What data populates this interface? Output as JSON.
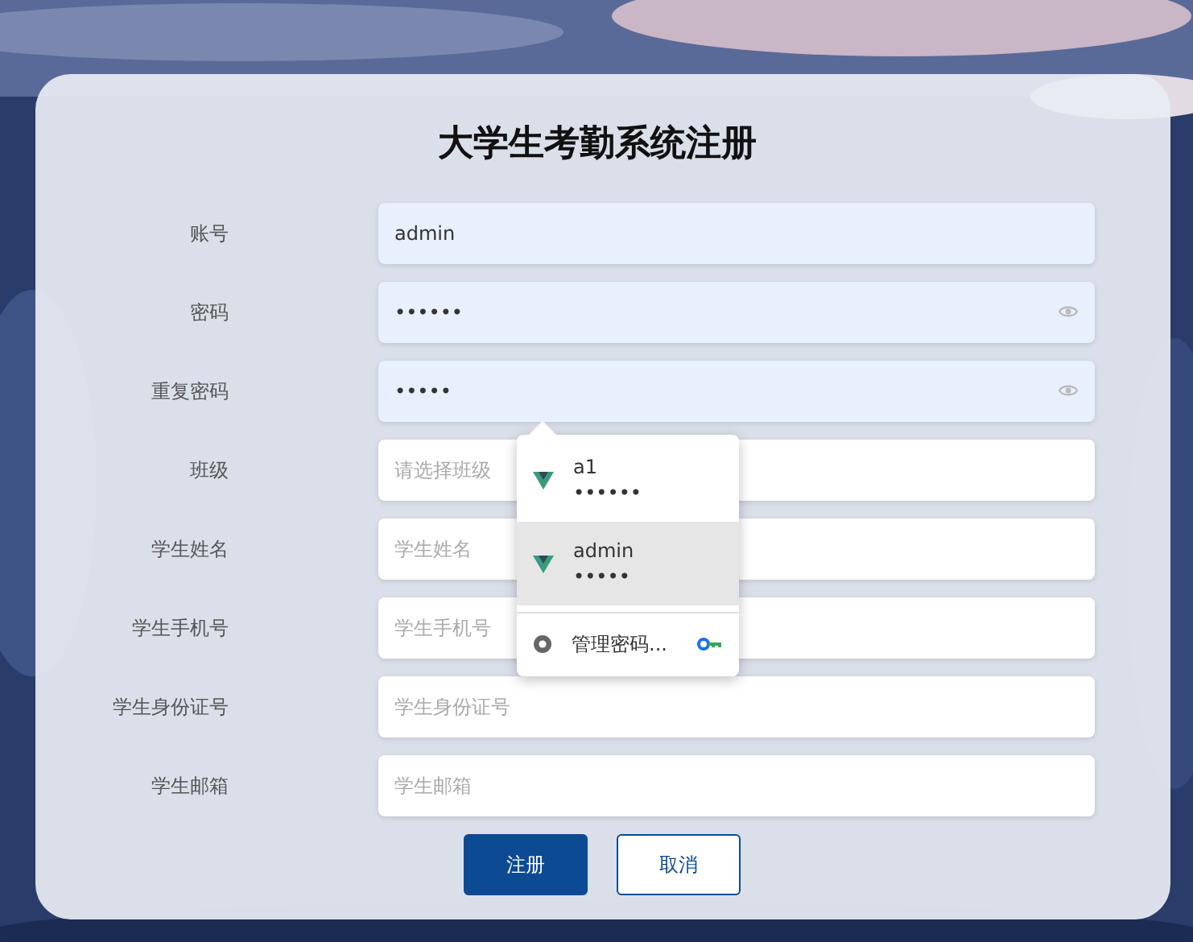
{
  "title": "大学生考勤系统注册",
  "fields": [
    {
      "label": "账号",
      "kind": "text",
      "value": "admin",
      "autofilled": true
    },
    {
      "label": "密码",
      "kind": "password",
      "value": "••••••",
      "autofilled": true
    },
    {
      "label": "重复密码",
      "kind": "password",
      "value": "•••••",
      "autofilled": true
    },
    {
      "label": "班级",
      "kind": "select",
      "placeholder": "请选择班级",
      "autofilled": false
    },
    {
      "label": "学生姓名",
      "kind": "text",
      "placeholder": "学生姓名",
      "autofilled": false
    },
    {
      "label": "学生手机号",
      "kind": "text",
      "placeholder": "学生手机号",
      "autofilled": false
    },
    {
      "label": "学生身份证号",
      "kind": "text",
      "placeholder": "学生身份证号",
      "autofilled": false
    },
    {
      "label": "学生邮箱",
      "kind": "text",
      "placeholder": "学生邮箱",
      "autofilled": false
    }
  ],
  "autofill_popup": {
    "entries": [
      {
        "username": "a1",
        "password": "••••••",
        "selected": false
      },
      {
        "username": "admin",
        "password": "•••••",
        "selected": true
      }
    ],
    "manage_label": "管理密码..."
  },
  "buttons": [
    {
      "label": "注册",
      "kind": "primary"
    },
    {
      "label": "取消",
      "kind": "secondary"
    }
  ]
}
